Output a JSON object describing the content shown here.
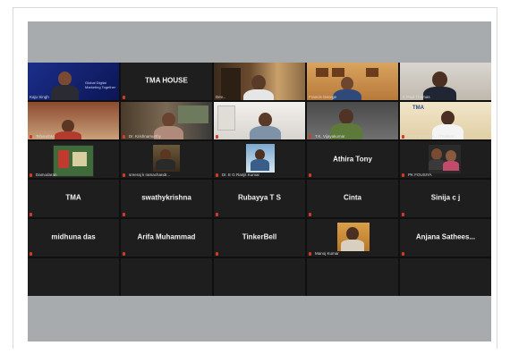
{
  "participants": [
    {
      "caption": "Kaju Singh",
      "big": ""
    },
    {
      "caption": "",
      "big": "TMA HOUSE"
    },
    {
      "caption": "Dev...",
      "big": ""
    },
    {
      "caption": "Francis George",
      "big": ""
    },
    {
      "caption": "K Paul Thomas",
      "big": ""
    },
    {
      "caption": "Tshandran",
      "big": ""
    },
    {
      "caption": "Dr. Krishnamurthy",
      "big": ""
    },
    {
      "caption": "Ajit Joseph",
      "big": ""
    },
    {
      "caption": "T.K. Vijayakumar",
      "big": ""
    },
    {
      "caption": "Dr. V M Zavier... (Thakkal...",
      "big": ""
    },
    {
      "caption": "Damodaran",
      "big": ""
    },
    {
      "caption": "sreeraj k ramachandr...",
      "big": ""
    },
    {
      "caption": "Dr. E G Ranjit Kumar",
      "big": ""
    },
    {
      "caption": "",
      "big": "Athira Tony"
    },
    {
      "caption": "PK FOUSIYA",
      "big": ""
    },
    {
      "caption": "",
      "big": "TMA"
    },
    {
      "caption": "",
      "big": "swathykrishna"
    },
    {
      "caption": "",
      "big": "Rubayya T S"
    },
    {
      "caption": "",
      "big": "Cinta"
    },
    {
      "caption": "",
      "big": "Sinija c j"
    },
    {
      "caption": "",
      "big": "midhuna das"
    },
    {
      "caption": "",
      "big": "Arifa Muhammad"
    },
    {
      "caption": "",
      "big": "TinkerBell"
    },
    {
      "caption": "Manoj Kumar",
      "big": ""
    },
    {
      "caption": "",
      "big": "Anjana  Sathees..."
    }
  ],
  "banner_text": {
    "line1": "Global Digital",
    "line2": "Marketing Together"
  },
  "tma_logo": "TMA",
  "colors": {
    "tile_bg": "#1e1e1e",
    "active_border": "#e8e14a",
    "band": "#a8abae"
  }
}
